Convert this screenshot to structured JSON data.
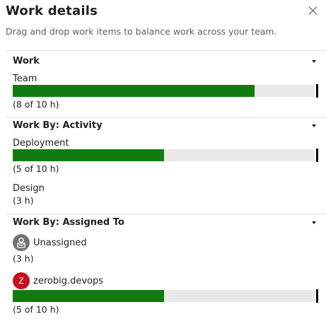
{
  "panel": {
    "title": "Work details",
    "subtitle": "Drag and drop work items to balance work across your team."
  },
  "colors": {
    "bar_fill": "#107c10",
    "bar_track": "#e9e9e9",
    "unassigned_avatar": "#737373",
    "user_avatar": "#c50f1f"
  },
  "sections": {
    "work": {
      "title": "Work",
      "items": [
        {
          "label": "Team",
          "summary": "(8 of 10 h)",
          "completed_hours": 8,
          "capacity_hours": 10
        }
      ]
    },
    "activity": {
      "title": "Work By: Activity",
      "items": [
        {
          "label": "Deployment",
          "summary": "(5 of 10 h)",
          "completed_hours": 5,
          "capacity_hours": 10
        },
        {
          "label": "Design",
          "summary": "(3 h)"
        }
      ]
    },
    "assigned": {
      "title": "Work By: Assigned To",
      "items": [
        {
          "name": "Unassigned",
          "summary": "(3 h)",
          "icon": "unassigned-avatar-icon"
        },
        {
          "name": "zerobig.devops",
          "initial": "Z",
          "summary": "(5 of 10 h)",
          "completed_hours": 5,
          "capacity_hours": 10
        }
      ]
    }
  }
}
